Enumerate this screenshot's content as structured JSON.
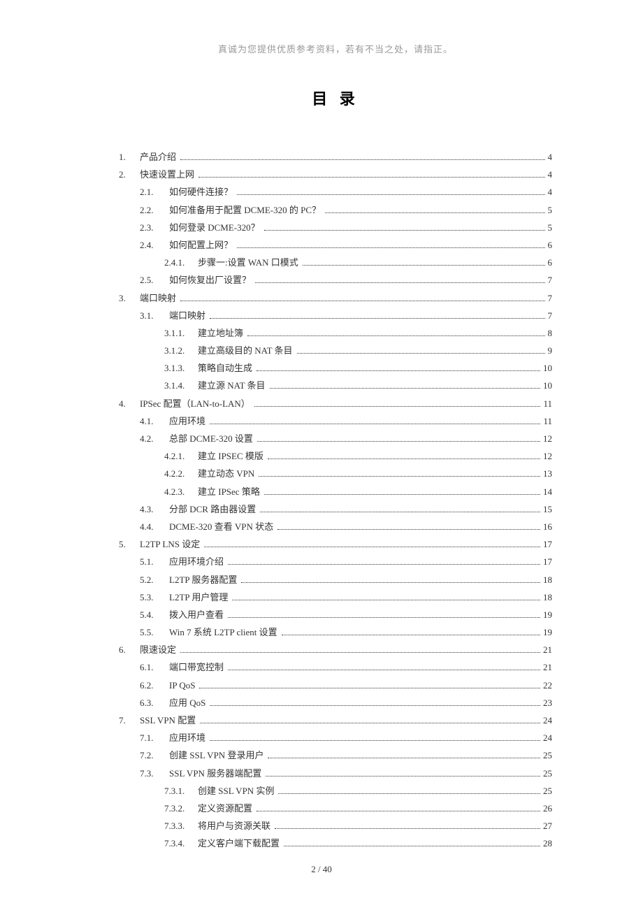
{
  "header_note": "真诚为您提供优质参考资料，若有不当之处，请指正。",
  "title": "目 录",
  "footer": "2 / 40",
  "toc": [
    {
      "level": 1,
      "num": "1.",
      "label": "产品介绍",
      "page": "4"
    },
    {
      "level": 1,
      "num": "2.",
      "label": "快速设置上网",
      "page": "4"
    },
    {
      "level": 2,
      "num": "2.1.",
      "label": "如何硬件连接？",
      "page": "4"
    },
    {
      "level": 2,
      "num": "2.2.",
      "label": "如何准备用于配置 DCME-320 的 PC？",
      "page": "5"
    },
    {
      "level": 2,
      "num": "2.3.",
      "label": "如何登录 DCME-320？",
      "page": "5"
    },
    {
      "level": 2,
      "num": "2.4.",
      "label": "如何配置上网？",
      "page": "6"
    },
    {
      "level": 3,
      "num": "2.4.1.",
      "label": "步骤一:设置 WAN 口模式",
      "page": "6"
    },
    {
      "level": 2,
      "num": "2.5.",
      "label": "如何恢复出厂设置？",
      "page": "7"
    },
    {
      "level": 1,
      "num": "3.",
      "label": "端口映射",
      "page": "7"
    },
    {
      "level": 2,
      "num": "3.1.",
      "label": "端口映射",
      "page": "7"
    },
    {
      "level": 3,
      "num": "3.1.1.",
      "label": "建立地址簿",
      "page": "8"
    },
    {
      "level": 3,
      "num": "3.1.2.",
      "label": "建立高级目的 NAT 条目",
      "page": "9"
    },
    {
      "level": 3,
      "num": "3.1.3.",
      "label": "策略自动生成",
      "page": "10"
    },
    {
      "level": 3,
      "num": "3.1.4.",
      "label": "建立源 NAT 条目",
      "page": "10"
    },
    {
      "level": 1,
      "num": "4.",
      "label": "IPSec 配置（LAN-to-LAN）",
      "page": "11"
    },
    {
      "level": 2,
      "num": "4.1.",
      "label": "应用环境",
      "page": "11"
    },
    {
      "level": 2,
      "num": "4.2.",
      "label": "总部 DCME-320 设置",
      "page": "12"
    },
    {
      "level": 3,
      "num": "4.2.1.",
      "label": "建立 IPSEC 模版",
      "page": "12"
    },
    {
      "level": 3,
      "num": "4.2.2.",
      "label": "建立动态 VPN",
      "page": "13"
    },
    {
      "level": 3,
      "num": "4.2.3.",
      "label": "建立 IPSec 策略",
      "page": "14"
    },
    {
      "level": 2,
      "num": "4.3.",
      "label": "分部 DCR 路由器设置",
      "page": "15"
    },
    {
      "level": 2,
      "num": "4.4.",
      "label": "DCME-320 查看 VPN 状态",
      "page": "16"
    },
    {
      "level": 1,
      "num": "5.",
      "label": "L2TP LNS 设定",
      "page": "17"
    },
    {
      "level": 2,
      "num": "5.1.",
      "label": "应用环境介绍",
      "page": "17"
    },
    {
      "level": 2,
      "num": "5.2.",
      "label": "L2TP 服务器配置",
      "page": "18"
    },
    {
      "level": 2,
      "num": "5.3.",
      "label": "L2TP 用户管理",
      "page": "18"
    },
    {
      "level": 2,
      "num": "5.4.",
      "label": "拨入用户查看",
      "page": "19"
    },
    {
      "level": 2,
      "num": "5.5.",
      "label": "Win 7 系统 L2TP client  设置",
      "page": "19"
    },
    {
      "level": 1,
      "num": "6.",
      "label": "限速设定",
      "page": "21"
    },
    {
      "level": 2,
      "num": "6.1.",
      "label": "端口带宽控制",
      "page": "21"
    },
    {
      "level": 2,
      "num": "6.2.",
      "label": "IP QoS",
      "page": "22"
    },
    {
      "level": 2,
      "num": "6.3.",
      "label": "应用 QoS",
      "page": "23"
    },
    {
      "level": 1,
      "num": "7.",
      "label": "SSL VPN 配置",
      "page": "24"
    },
    {
      "level": 2,
      "num": "7.1.",
      "label": "应用环境",
      "page": "24"
    },
    {
      "level": 2,
      "num": "7.2.",
      "label": "创建 SSL VPN 登录用户",
      "page": "25"
    },
    {
      "level": 2,
      "num": "7.3.",
      "label": "SSL VPN 服务器端配置",
      "page": "25"
    },
    {
      "level": 3,
      "num": "7.3.1.",
      "label": "创建 SSL VPN 实例",
      "page": "25"
    },
    {
      "level": 3,
      "num": "7.3.2.",
      "label": "定义资源配置",
      "page": "26"
    },
    {
      "level": 3,
      "num": "7.3.3.",
      "label": "将用户与资源关联",
      "page": "27"
    },
    {
      "level": 3,
      "num": "7.3.4.",
      "label": "定义客户端下载配置",
      "page": "28"
    }
  ]
}
